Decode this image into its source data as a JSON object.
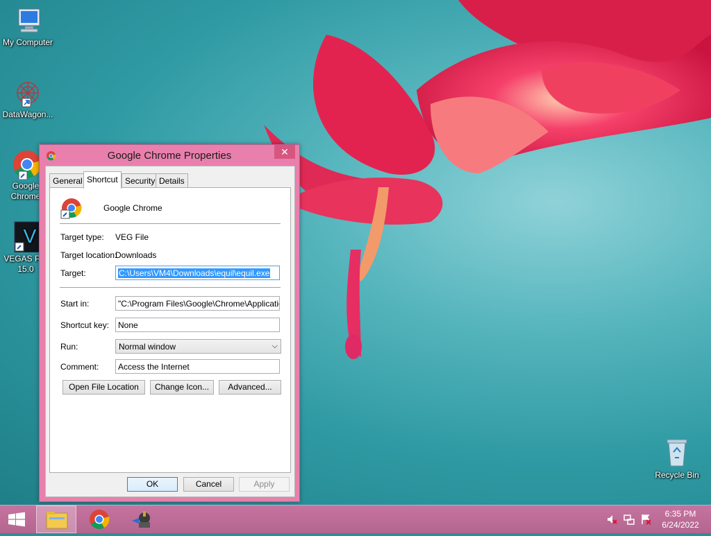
{
  "desktop": {
    "icons": [
      {
        "label": "My Computer"
      },
      {
        "label": "DataWagon..."
      },
      {
        "label": "Google Chrome"
      },
      {
        "label": "VEGAS Pro 15.0"
      },
      {
        "label": "Recycle Bin"
      }
    ]
  },
  "dialog": {
    "title": "Google Chrome Properties",
    "close_label": "✕",
    "tabs": [
      {
        "label": "General"
      },
      {
        "label": "Shortcut"
      },
      {
        "label": "Security"
      },
      {
        "label": "Details"
      }
    ],
    "active_tab": "Shortcut",
    "app_name": "Google Chrome",
    "fields": {
      "target_type_label": "Target type:",
      "target_type_value": "VEG File",
      "target_location_label": "Target location:",
      "target_location_value": "Downloads",
      "target_label": "Target:",
      "target_value": "C:\\Users\\VM4\\Downloads\\equil\\equil.exe",
      "start_in_label": "Start in:",
      "start_in_value": "\"C:\\Program Files\\Google\\Chrome\\Application\"",
      "shortcut_key_label": "Shortcut key:",
      "shortcut_key_value": "None",
      "run_label": "Run:",
      "run_value": "Normal window",
      "comment_label": "Comment:",
      "comment_value": "Access the Internet"
    },
    "buttons": {
      "open_file_location": "Open File Location",
      "change_icon": "Change Icon...",
      "advanced": "Advanced...",
      "ok": "OK",
      "cancel": "Cancel",
      "apply": "Apply"
    }
  },
  "taskbar": {
    "clock_time": "6:35 PM",
    "clock_date": "6/24/2022"
  },
  "colors": {
    "accent": "#e97fad",
    "taskbar": "#b36690",
    "selection": "#3399ff"
  }
}
